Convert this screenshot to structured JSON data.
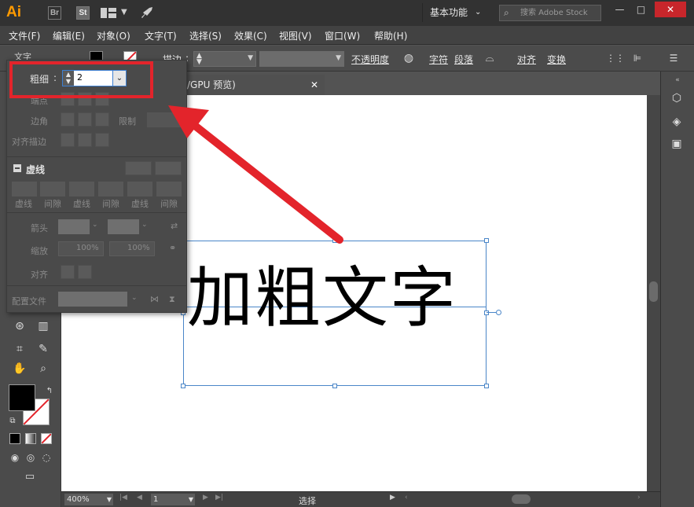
{
  "app": {
    "logo_text": "Ai",
    "bridge": "Br",
    "stock": "St",
    "workspace": "基本功能",
    "search_placeholder": "搜索 Adobe Stock",
    "minimize": "—",
    "maximize": "□",
    "close": "✕"
  },
  "menu": [
    "文件(F)",
    "编辑(E)",
    "对象(O)",
    "文字(T)",
    "选择(S)",
    "效果(C)",
    "视图(V)",
    "窗口(W)",
    "帮助(H)"
  ],
  "control": {
    "type_label": "文字",
    "stroke_label": "描边",
    "opacity_label": "不透明度",
    "char_label": "字符",
    "para_label": "段落",
    "align_label": "对齐",
    "transform_label": "变换"
  },
  "document": {
    "tab_title": "/GPU 预览)",
    "tab_close": "✕",
    "text_content": "加粗文字"
  },
  "status": {
    "zoom": "400%",
    "page": "1",
    "tool": "选择"
  },
  "stroke_panel": {
    "weight_label": "粗细",
    "weight_value": "2",
    "cap_label": "端点",
    "corner_label": "边角",
    "limit_label": "限制",
    "align_label": "对齐描边",
    "dashed_label": "虚线",
    "dash_labels": [
      "虚线",
      "间隙",
      "虚线",
      "间隙",
      "虚线",
      "间隙"
    ],
    "arrow_label": "箭头",
    "scale_label": "缩放",
    "scale_value_1": "100%",
    "scale_value_2": "100%",
    "align_arrow_label": "对齐",
    "profile_label": "配置文件"
  },
  "colors": {
    "highlight": "#e3242b",
    "selection": "#4a86c8",
    "brand": "#ff9a00"
  }
}
